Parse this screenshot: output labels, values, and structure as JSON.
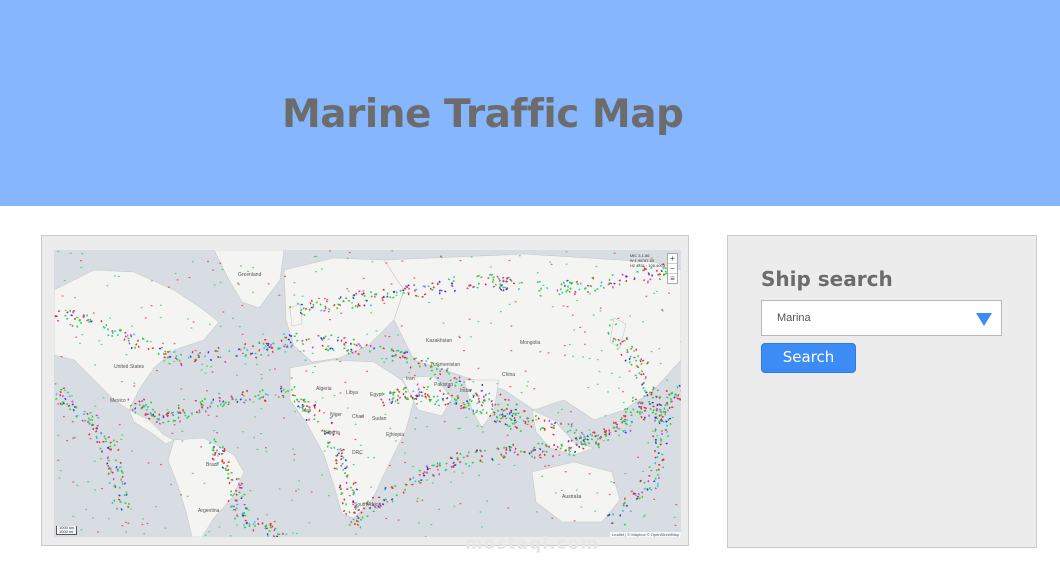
{
  "header": {
    "title": "Marine Traffic Map",
    "background": "#86b7fe"
  },
  "map": {
    "zoom_in": "+",
    "zoom_out": "−",
    "layers_icon": "layers-icon",
    "coords": [
      "MIC 3.1.86",
      "W:1.98°87.55",
      "H2 4331 : 106.4003"
    ],
    "scale": [
      "1000 km",
      "1000 mi"
    ],
    "attribution": "Leaflet | © Mapbox © OpenStreetMap",
    "labels": {
      "kazakhstan": "Kazakhstan",
      "mongolia": "Mongolia",
      "china": "China",
      "india": "India",
      "iran": "Iran",
      "algeria": "Algeria",
      "libya": "Libya",
      "egypt": "Egypt",
      "mali": "Mali",
      "niger": "Niger",
      "chad": "Chad",
      "sudan": "Sudan",
      "ethiopia": "Ethiopia",
      "nigeria": "Nigeria",
      "drc": "DRC",
      "brazil": "Brazil",
      "south_africa": "South Africa",
      "australia": "Australia",
      "united_states": "United States",
      "mexico": "Mexico",
      "greenland": "Greenland",
      "turkmenistan": "Turkmenistan",
      "pakistan": "Pakistan",
      "argentina": "Argentina"
    },
    "colors": {
      "cargo": "#2ecc40",
      "tanker": "#e0302a",
      "passenger": "#2fc4e0",
      "other": "#2a3dbf",
      "special": "#d43cc9"
    }
  },
  "search": {
    "heading": "Ship search",
    "selected": "Marina",
    "button_label": "Search",
    "accent": "#3d8bf5"
  },
  "watermark": "mostaql.com"
}
